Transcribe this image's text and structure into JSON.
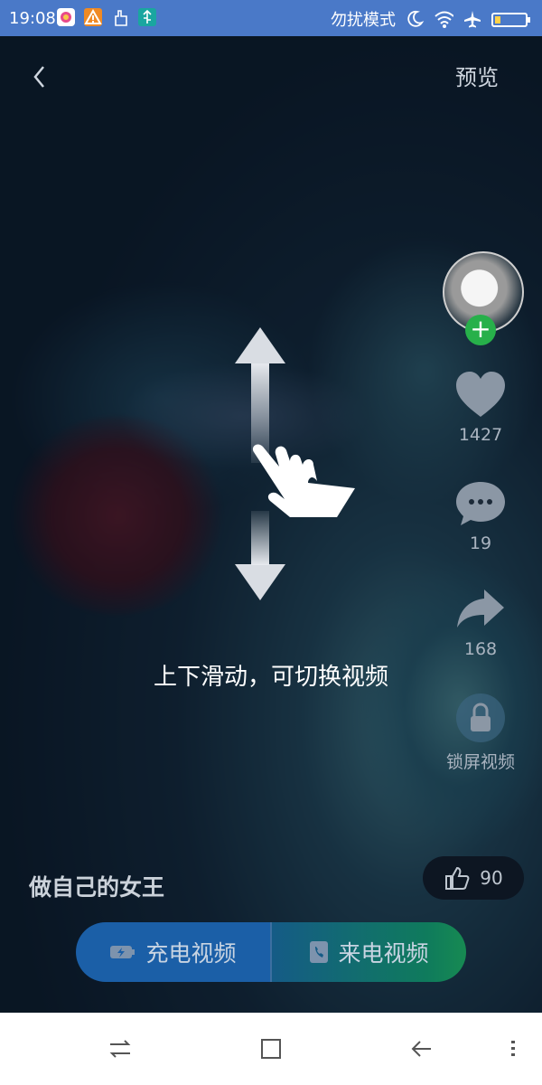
{
  "status_bar": {
    "time": "19:08",
    "dnd_label": "勿扰模式",
    "icons_left": [
      "app-icon",
      "warning-icon",
      "hand-icon",
      "usb-icon"
    ],
    "icons_right": [
      "moon-icon",
      "wifi-icon",
      "airplane-icon",
      "battery-icon"
    ]
  },
  "header": {
    "back_icon": "chevron-left-icon",
    "preview_label": "预览"
  },
  "side_panel": {
    "like_count": "1427",
    "comment_count": "19",
    "share_count": "168",
    "lock_label": "锁屏视频"
  },
  "hint": {
    "text": "上下滑动，可切换视频"
  },
  "video": {
    "title": "做自己的女王",
    "thumbs_count": "90"
  },
  "actions": {
    "charge_label": "充电视频",
    "call_label": "来电视频"
  },
  "colors": {
    "status_bar": "#4a79c8",
    "follow_green": "#27b04a",
    "charge_blue": "#1b5fa7",
    "call_green": "#178a52"
  }
}
